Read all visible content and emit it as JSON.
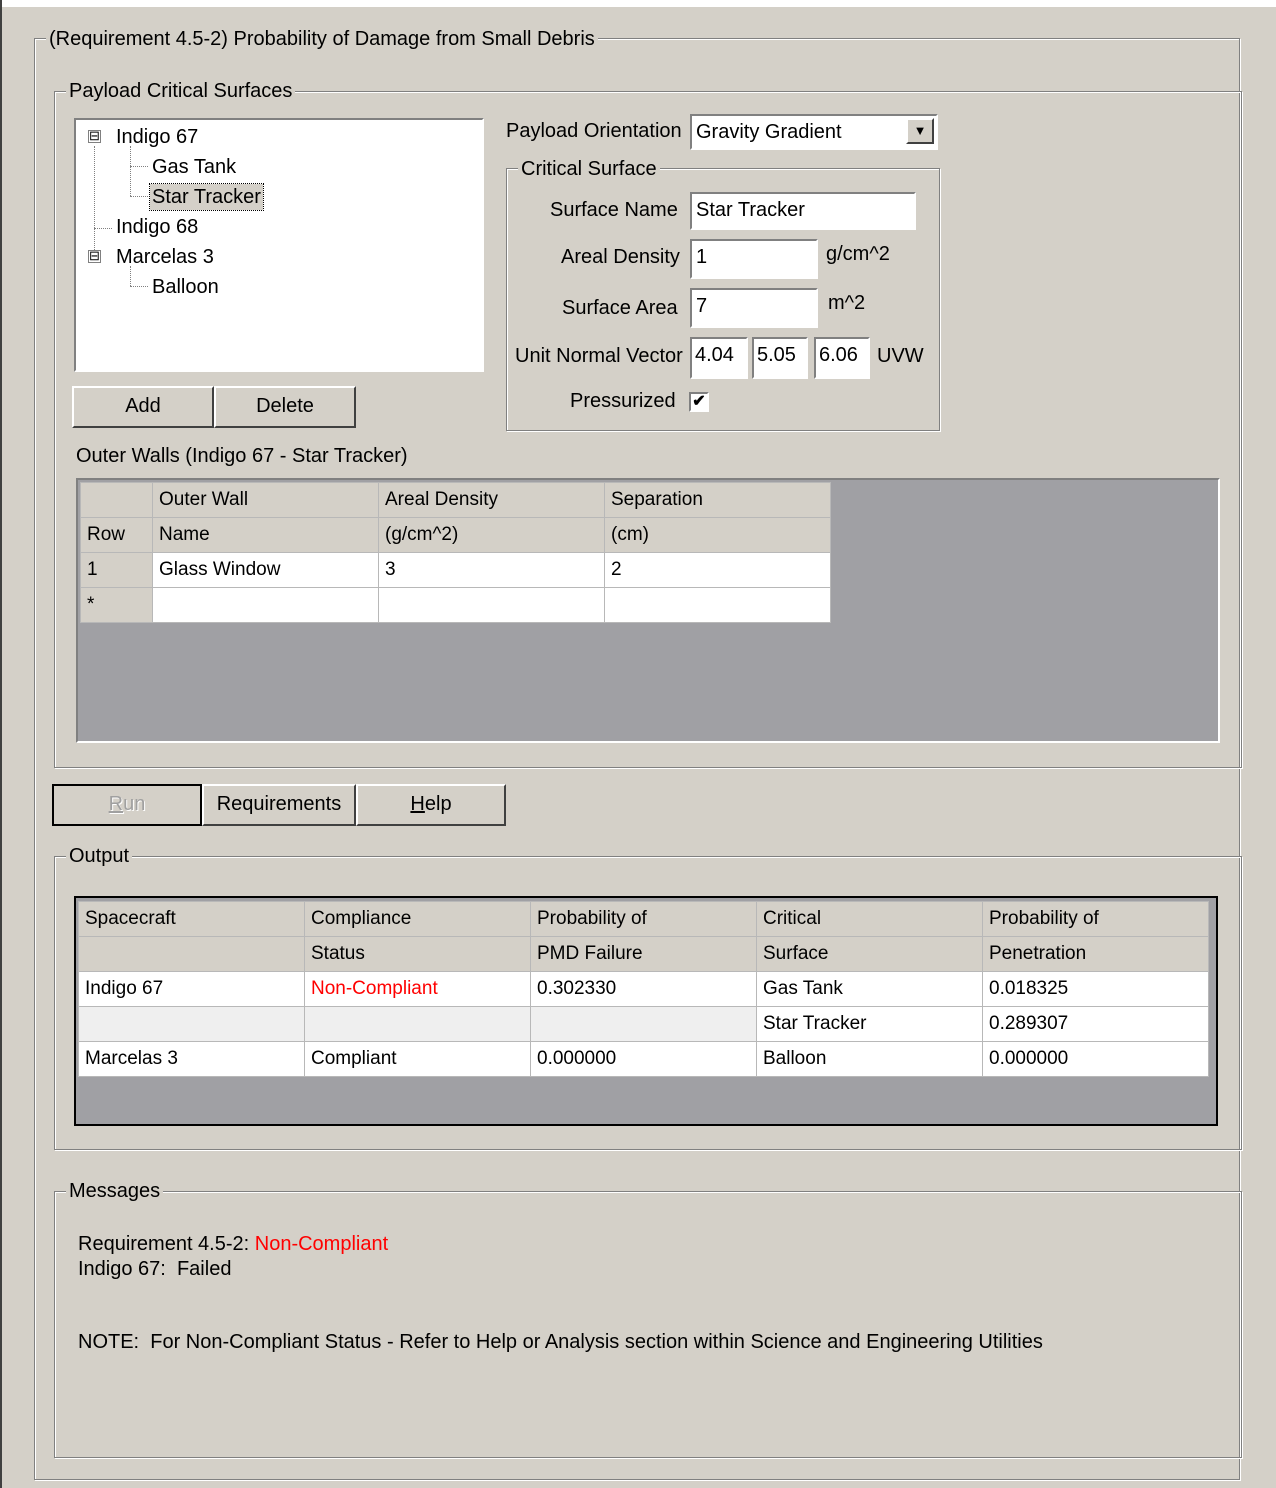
{
  "main_group": {
    "title": "(Requirement 4.5-2) Probability of Damage from Small Debris"
  },
  "payload": {
    "title": "Payload Critical Surfaces",
    "tree": {
      "items": [
        {
          "label": "Indigo 67",
          "expander": "⊟"
        },
        {
          "label": "Gas Tank"
        },
        {
          "label": "Star Tracker",
          "selected": true
        },
        {
          "label": "Indigo 68"
        },
        {
          "label": "Marcelas 3",
          "expander": "⊟"
        },
        {
          "label": "Balloon"
        }
      ]
    },
    "add_label": "Add",
    "delete_label": "Delete",
    "orientation_label": "Payload Orientation",
    "orientation_value": "Gravity Gradient",
    "critical_surface": {
      "title": "Critical Surface",
      "surface_name_label": "Surface Name",
      "surface_name_value": "Star Tracker",
      "areal_density_label": "Areal Density",
      "areal_density_value": "1",
      "areal_density_unit": "g/cm^2",
      "surface_area_label": "Surface Area",
      "surface_area_value": "7",
      "surface_area_unit": "m^2",
      "unit_normal_label": "Unit Normal Vector",
      "unit_normal_u": "4.04",
      "unit_normal_v": "5.05",
      "unit_normal_w": "6.06",
      "unit_normal_unit": "UVW",
      "pressurized_label": "Pressurized",
      "pressurized_checked": true,
      "check_glyph": "✔"
    },
    "outer_walls": {
      "title": "Outer Walls (Indigo 67 - Star Tracker)",
      "header1": [
        "",
        "Outer Wall",
        "Areal Density",
        "Separation"
      ],
      "header2": [
        "Row",
        "Name",
        "(g/cm^2)",
        "(cm)"
      ],
      "rows": [
        [
          "1",
          "Glass Window",
          "3",
          "2"
        ],
        [
          "*",
          "",
          "",
          ""
        ]
      ]
    }
  },
  "actions": {
    "run_label": "Run",
    "requirements_label": "Requirements",
    "help_label": "Help"
  },
  "output": {
    "title": "Output",
    "header1": [
      "Spacecraft",
      "Compliance",
      "Probability of",
      "Critical",
      "Probability of"
    ],
    "header2": [
      "",
      "Status",
      "PMD Failure",
      "Surface",
      "Penetration"
    ],
    "rows": [
      [
        "Indigo 67",
        "Non-Compliant",
        "0.302330",
        "Gas Tank",
        "0.018325"
      ],
      [
        "",
        "",
        "",
        "Star Tracker",
        "0.289307"
      ],
      [
        "Marcelas 3",
        "Compliant",
        "0.000000",
        "Balloon",
        "0.000000"
      ]
    ],
    "noncompliant_color": "#ff0000"
  },
  "messages": {
    "title": "Messages",
    "line1_prefix": "Requirement 4.5-2: ",
    "line1_status": "Non-Compliant",
    "line2": "Indigo 67:  Failed",
    "note": "NOTE:  For Non-Compliant Status - Refer to Help or Analysis section within Science and Engineering Utilities"
  }
}
